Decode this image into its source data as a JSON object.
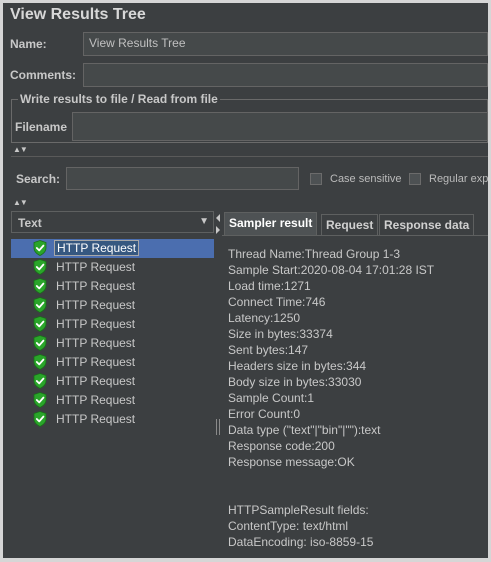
{
  "title": "View Results Tree",
  "form": {
    "name_label": "Name:",
    "name_value": "View Results Tree",
    "comments_label": "Comments:",
    "comments_value": "",
    "file_group_legend": "Write results to file / Read from file",
    "filename_label": "Filename",
    "filename_value": ""
  },
  "search": {
    "label": "Search:",
    "value": "",
    "case_sensitive_label": "Case sensitive",
    "regular_exp_label": "Regular exp"
  },
  "tree": {
    "header": "Text",
    "items": [
      {
        "label": "HTTP Request",
        "selected": true
      },
      {
        "label": "HTTP Request",
        "selected": false
      },
      {
        "label": "HTTP Request",
        "selected": false
      },
      {
        "label": "HTTP Request",
        "selected": false
      },
      {
        "label": "HTTP Request",
        "selected": false
      },
      {
        "label": "HTTP Request",
        "selected": false
      },
      {
        "label": "HTTP Request",
        "selected": false
      },
      {
        "label": "HTTP Request",
        "selected": false
      },
      {
        "label": "HTTP Request",
        "selected": false
      },
      {
        "label": "HTTP Request",
        "selected": false
      }
    ],
    "item_icon": "green-shield-check-icon"
  },
  "result_tabs": [
    {
      "label": "Sampler result",
      "active": true
    },
    {
      "label": "Request",
      "active": false
    },
    {
      "label": "Response data",
      "active": false
    }
  ],
  "sampler_result": [
    "Thread Name:Thread Group 1-3",
    "Sample Start:2020-08-04 17:01:28 IST",
    "Load time:1271",
    "Connect Time:746",
    "Latency:1250",
    "Size in bytes:33374",
    "Sent bytes:147",
    "Headers size in bytes:344",
    "Body size in bytes:33030",
    "Sample Count:1",
    "Error Count:0",
    "Data type (\"text\"|\"bin\"|\"\"):text",
    "Response code:200",
    "Response message:OK",
    "",
    "",
    "HTTPSampleResult fields:",
    "ContentType: text/html",
    "DataEncoding: iso-8859-15"
  ],
  "colors": {
    "panel_bg": "#3c3f41",
    "selection": "#4b6eaf",
    "success_icon": "#2aa52a"
  }
}
